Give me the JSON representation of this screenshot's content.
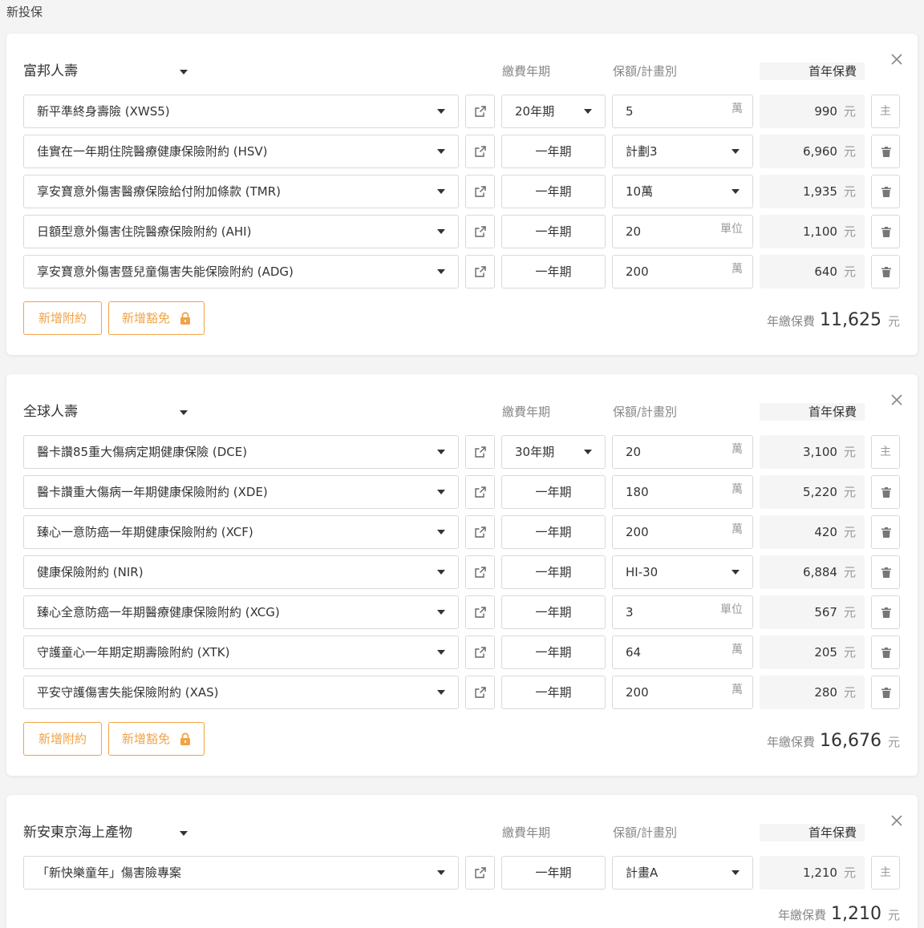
{
  "page_title": "新投保",
  "headers": {
    "term": "繳費年期",
    "amount": "保額/計畫別",
    "premium": "首年保費"
  },
  "currency": "元",
  "total_label": "年繳保費",
  "buttons": {
    "add_rider": "新增附約",
    "add_waiver": "新增豁免"
  },
  "main_badge": "主",
  "icons": {
    "close": "close-icon",
    "external": "external-link-icon",
    "delete": "trash-icon",
    "lock": "lock-icon",
    "dropdown": "chevron-down-icon"
  },
  "colors": {
    "accent": "#f0a347",
    "premium_bg": "#f5f5f5"
  },
  "companies": [
    {
      "name": "富邦人壽",
      "total": "11,625",
      "products": [
        {
          "name": "新平準終身壽險 (XWS5)",
          "term": "20年期",
          "term_select": true,
          "amount": "5",
          "unit": "萬",
          "amount_select": false,
          "premium": "990",
          "main": true
        },
        {
          "name": "佳實在一年期住院醫療健康保險附約 (HSV)",
          "term": "一年期",
          "term_select": false,
          "amount": "計劃3",
          "unit": "",
          "amount_select": true,
          "premium": "6,960",
          "main": false
        },
        {
          "name": "享安寶意外傷害醫療保險給付附加條款 (TMR)",
          "term": "一年期",
          "term_select": false,
          "amount": "10萬",
          "unit": "",
          "amount_select": true,
          "premium": "1,935",
          "main": false
        },
        {
          "name": "日額型意外傷害住院醫療保險附約 (AHI)",
          "term": "一年期",
          "term_select": false,
          "amount": "20",
          "unit": "單位",
          "amount_select": false,
          "premium": "1,100",
          "main": false
        },
        {
          "name": "享安寶意外傷害暨兒童傷害失能保險附約 (ADG)",
          "term": "一年期",
          "term_select": false,
          "amount": "200",
          "unit": "萬",
          "amount_select": false,
          "premium": "640",
          "main": false
        }
      ]
    },
    {
      "name": "全球人壽",
      "total": "16,676",
      "products": [
        {
          "name": "醫卡讚85重大傷病定期健康保險 (DCE)",
          "term": "30年期",
          "term_select": true,
          "amount": "20",
          "unit": "萬",
          "amount_select": false,
          "premium": "3,100",
          "main": true
        },
        {
          "name": "醫卡讚重大傷病一年期健康保險附約 (XDE)",
          "term": "一年期",
          "term_select": false,
          "amount": "180",
          "unit": "萬",
          "amount_select": false,
          "premium": "5,220",
          "main": false
        },
        {
          "name": "臻心一意防癌一年期健康保險附約 (XCF)",
          "term": "一年期",
          "term_select": false,
          "amount": "200",
          "unit": "萬",
          "amount_select": false,
          "premium": "420",
          "main": false
        },
        {
          "name": "健康保險附約 (NIR)",
          "term": "一年期",
          "term_select": false,
          "amount": "HI-30",
          "unit": "",
          "amount_select": true,
          "premium": "6,884",
          "main": false
        },
        {
          "name": "臻心全意防癌一年期醫療健康保險附約 (XCG)",
          "term": "一年期",
          "term_select": false,
          "amount": "3",
          "unit": "單位",
          "amount_select": false,
          "premium": "567",
          "main": false
        },
        {
          "name": "守護童心一年期定期壽險附約 (XTK)",
          "term": "一年期",
          "term_select": false,
          "amount": "64",
          "unit": "萬",
          "amount_select": false,
          "premium": "205",
          "main": false
        },
        {
          "name": "平安守護傷害失能保險附約 (XAS)",
          "term": "一年期",
          "term_select": false,
          "amount": "200",
          "unit": "萬",
          "amount_select": false,
          "premium": "280",
          "main": false
        }
      ]
    },
    {
      "name": "新安東京海上產物",
      "total": "1,210",
      "products": [
        {
          "name": "「新快樂童年」傷害險專案",
          "term": "一年期",
          "term_select": false,
          "amount": "計畫A",
          "unit": "",
          "amount_select": true,
          "premium": "1,210",
          "main": true
        }
      ]
    }
  ]
}
